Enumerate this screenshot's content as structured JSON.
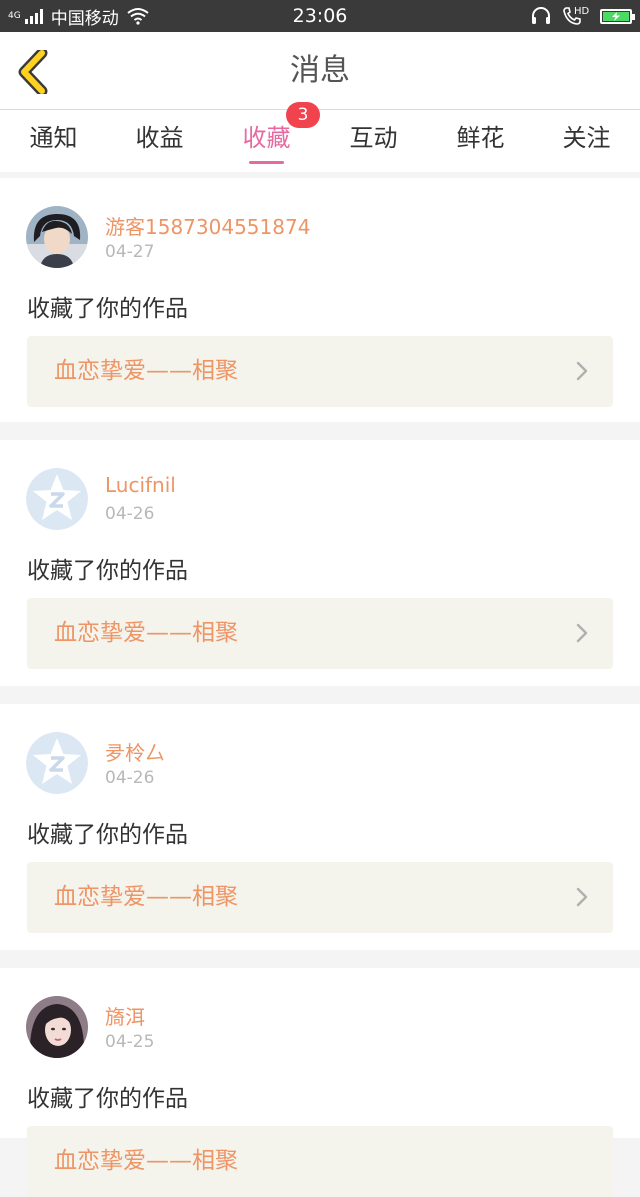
{
  "status_bar": {
    "network": "4G",
    "carrier": "中国移动",
    "time": "23:06",
    "hd": "HD",
    "battery_percent": 100,
    "icons": [
      "signal-icon",
      "wifi-icon",
      "headset-icon",
      "hd-call-icon",
      "battery-charging-icon"
    ]
  },
  "nav": {
    "title": "消息",
    "back_icon": "chevron-left-icon",
    "back_color": "#ffd21f"
  },
  "tabs": [
    {
      "label": "通知"
    },
    {
      "label": "收益"
    },
    {
      "label": "收藏",
      "active": true,
      "badge": "3"
    },
    {
      "label": "互动"
    },
    {
      "label": "鲜花"
    },
    {
      "label": "关注"
    }
  ],
  "colors": {
    "accent": "#e66aa0",
    "badge": "#f0434e",
    "username": "#ee9565",
    "work_link_bg": "#f4f3ec"
  },
  "items": [
    {
      "username": "游客1587304551874",
      "date": "04-27",
      "action": "收藏了你的作品",
      "work_title": "血恋挚爱——相聚",
      "avatar": "photo-avatar"
    },
    {
      "username": "Lucifnil",
      "date": "04-26",
      "action": "收藏了你的作品",
      "work_title": "血恋挚爱——相聚",
      "avatar": "default-avatar"
    },
    {
      "username": "夛柃厶",
      "date": "04-26",
      "action": "收藏了你的作品",
      "work_title": "血恋挚爱——相聚",
      "avatar": "default-avatar"
    },
    {
      "username": "旖洱",
      "date": "04-25",
      "action": "收藏了你的作品",
      "work_title": "血恋挚爱——相聚",
      "avatar": "photo-avatar"
    }
  ]
}
